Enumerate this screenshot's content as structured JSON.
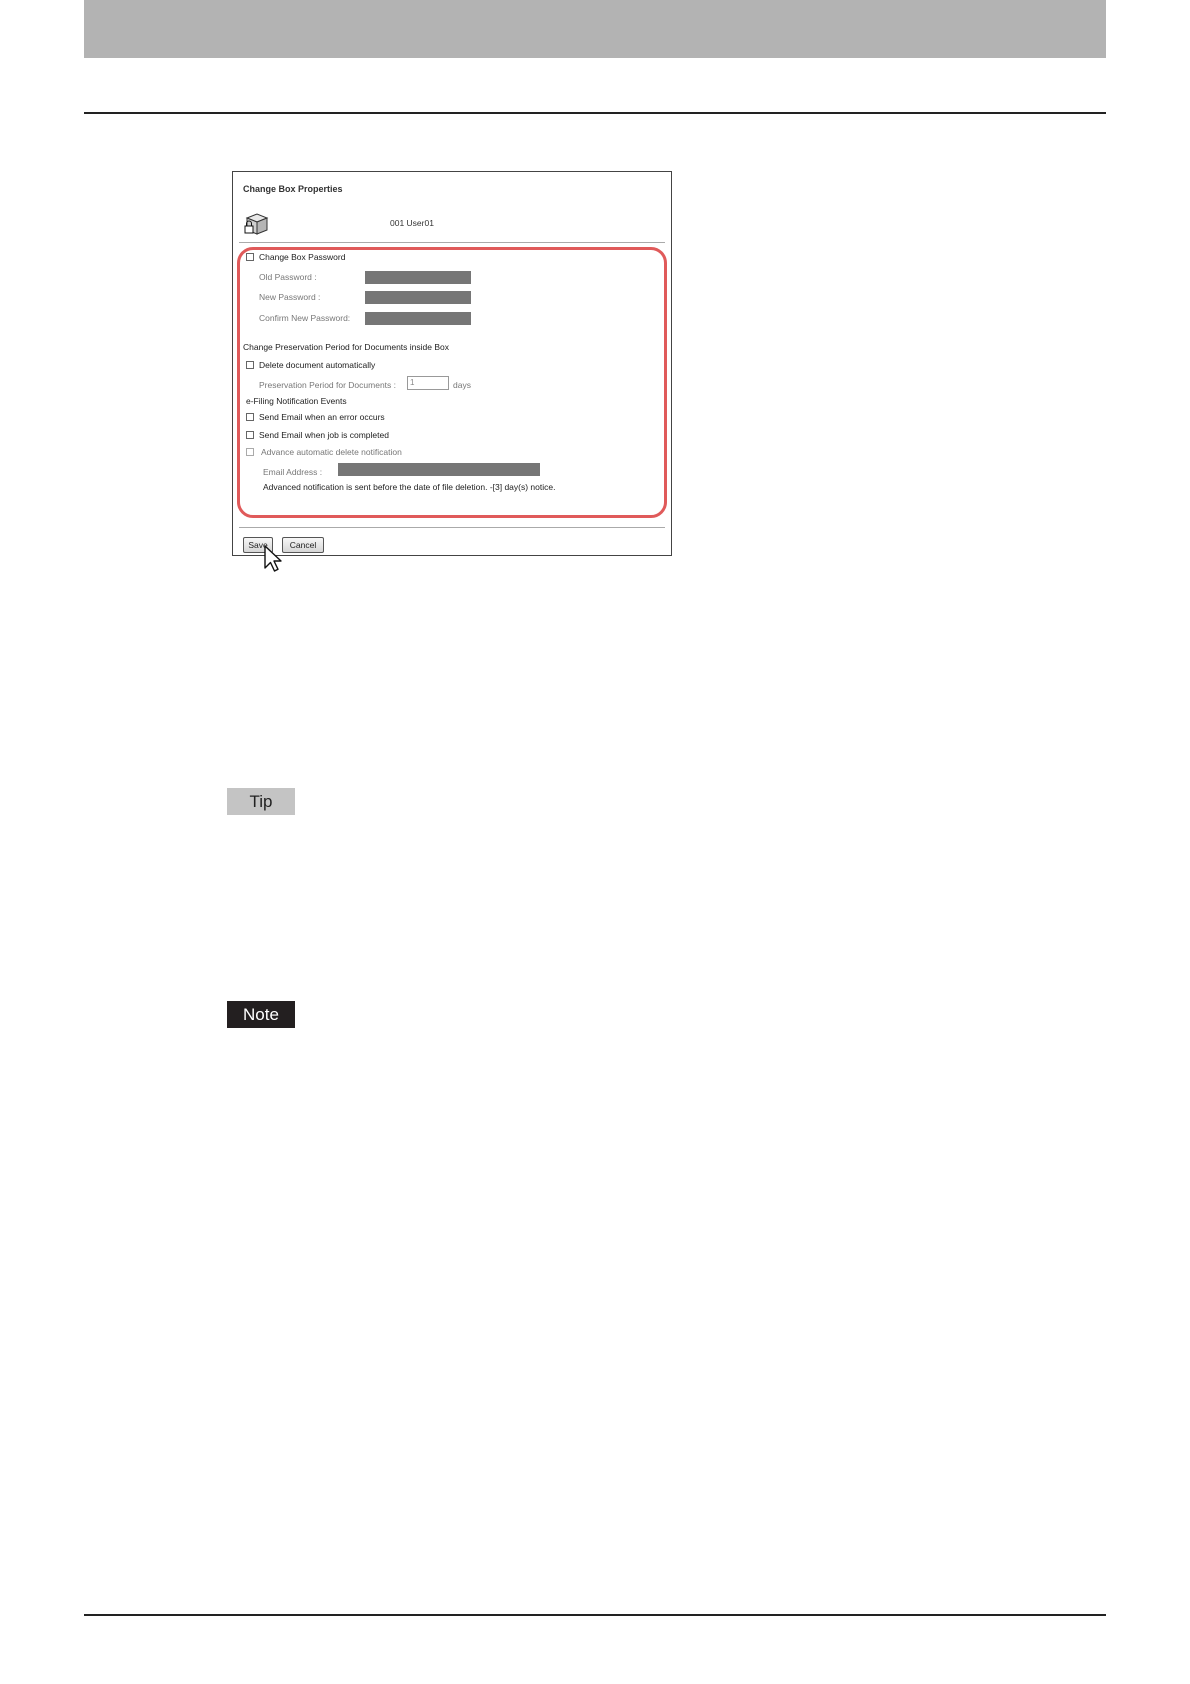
{
  "dialog": {
    "title": "Change Box Properties",
    "box_name": "001 User01",
    "change_password": {
      "label": "Change Box Password",
      "old_password_label": "Old Password :",
      "new_password_label": "New Password :",
      "confirm_password_label": "Confirm New Password:"
    },
    "preservation": {
      "heading": "Change Preservation Period for Documents inside Box",
      "delete_auto_label": "Delete document automatically",
      "period_label": "Preservation Period for Documents :",
      "period_value": "1",
      "period_unit": "days"
    },
    "notification": {
      "heading": "e-Filing Notification Events",
      "on_error_label": "Send Email when an error occurs",
      "on_complete_label": "Send Email when job is completed",
      "advance_delete_label": "Advance automatic delete notification",
      "email_label": "Email Address  :",
      "advance_note": "Advanced notification is sent before the date of file deletion. -[3] day(s) notice."
    },
    "buttons": {
      "save": "Save",
      "cancel": "Cancel"
    }
  },
  "tags": {
    "tip": "Tip",
    "note": "Note"
  },
  "colors": {
    "highlight": "#e05a5a",
    "header_band": "#b3b3b3",
    "note_bg": "#231f20",
    "tip_bg": "#c4c4c4"
  }
}
